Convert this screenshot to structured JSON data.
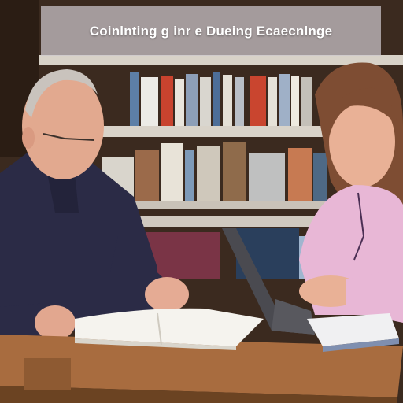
{
  "banner": {
    "text": "Coinlnting g inr e Dueing Ecaecnlnge"
  }
}
